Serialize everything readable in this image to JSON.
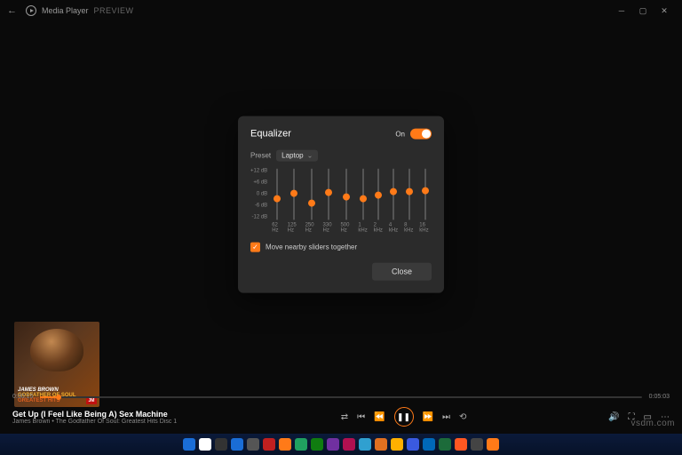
{
  "titlebar": {
    "app": "Media Player",
    "badge": "PREVIEW"
  },
  "equalizer": {
    "title": "Equalizer",
    "on_label": "On",
    "preset_label": "Preset",
    "preset_value": "Laptop",
    "db_labels": [
      "+12 dB",
      "+6 dB",
      "0 dB",
      "-6 dB",
      "-12 dB"
    ],
    "bands": [
      {
        "freq": "62 Hz",
        "pos": 52
      },
      {
        "freq": "125 Hz",
        "pos": 42
      },
      {
        "freq": "250 Hz",
        "pos": 60
      },
      {
        "freq": "330 Hz",
        "pos": 40
      },
      {
        "freq": "500 Hz",
        "pos": 48
      },
      {
        "freq": "1 kHz",
        "pos": 52
      },
      {
        "freq": "2 kHz",
        "pos": 44
      },
      {
        "freq": "4 kHz",
        "pos": 38
      },
      {
        "freq": "8 kHz",
        "pos": 38
      },
      {
        "freq": "16 kHz",
        "pos": 36
      }
    ],
    "checkbox_label": "Move nearby sliders together",
    "close_label": "Close"
  },
  "album": {
    "l1": "JAMES BROWN",
    "l2": "GODFATHER OF SOUL",
    "l3": "GREATEST HITS",
    "badge": "JM"
  },
  "track": {
    "title": "Get Up (I Feel Like Being A) Sex Machine",
    "subtitle": "James Brown • The Godfather Of Soul: Greatest Hits Disc 1"
  },
  "progress": {
    "elapsed": "0:00:15",
    "total": "0:05:03"
  },
  "taskbar_colors": [
    "#1a6dd6",
    "#ffffff",
    "#333",
    "#1a6dd6",
    "#555",
    "#c02020",
    "#ff7a18",
    "#20a060",
    "#107c10",
    "#7030a0",
    "#b01050",
    "#30a0d0",
    "#e07020",
    "#ffb000",
    "#3a5ae0",
    "#0068b8",
    "#1c6b3a",
    "#ff5722",
    "#444",
    "#ff7a18"
  ],
  "watermark": "vsdm.com"
}
